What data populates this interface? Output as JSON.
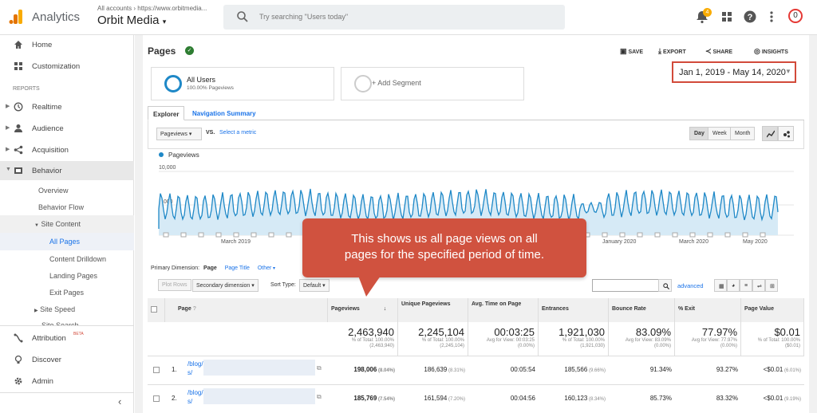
{
  "header": {
    "app": "Analytics",
    "accounts_crumb": "All accounts › https://www.orbitmedia...",
    "property": "Orbit Media",
    "search_placeholder": "Try searching \"Users today\"",
    "notifications": "4",
    "account_initial": "0"
  },
  "sidebar": {
    "home": "Home",
    "customization": "Customization",
    "reports_label": "REPORTS",
    "realtime": "Realtime",
    "audience": "Audience",
    "acquisition": "Acquisition",
    "behavior": "Behavior",
    "overview": "Overview",
    "behavior_flow": "Behavior Flow",
    "site_content": "Site Content",
    "all_pages": "All Pages",
    "content_drilldown": "Content Drilldown",
    "landing_pages": "Landing Pages",
    "exit_pages": "Exit Pages",
    "site_speed": "Site Speed",
    "site_search": "Site Search",
    "attribution": "Attribution",
    "beta": "BETA",
    "discover": "Discover",
    "admin": "Admin"
  },
  "report": {
    "title": "Pages",
    "save": "SAVE",
    "export": "EXPORT",
    "share": "SHARE",
    "insights": "INSIGHTS",
    "segment_name": "All Users",
    "segment_sub": "100.00% Pageviews",
    "add_segment": "+ Add Segment",
    "date_range": "Jan 1, 2019 - May 14, 2020",
    "tab_explorer": "Explorer",
    "tab_nav": "Navigation Summary",
    "metric": "Pageviews",
    "vs": "VS.",
    "select_metric": "Select a metric",
    "day": "Day",
    "week": "Week",
    "month": "Month",
    "legend": "Pageviews",
    "ymax": "10,000",
    "ymid": "5,000",
    "xlabels": [
      "March 2019",
      "January 2020",
      "March 2020",
      "May 2020"
    ],
    "primary_dimension": "Primary Dimension:",
    "dim_page": "Page",
    "dim_page_title": "Page Title",
    "dim_other": "Other",
    "plot_rows": "Plot Rows",
    "secondary_dimension": "Secondary dimension",
    "sort_type": "Sort Type:",
    "sort_default": "Default",
    "advanced": "advanced"
  },
  "callout": {
    "line1": "This shows us all page views on all",
    "line2": "pages for the specified period of time."
  },
  "table": {
    "headers": [
      "Page",
      "Pageviews",
      "Unique Pageviews",
      "Avg. Time on Page",
      "Entrances",
      "Bounce Rate",
      "% Exit",
      "Page Value"
    ],
    "totals": [
      {
        "big": "2,463,940",
        "s1": "% of Total: 100.00%",
        "s2": "(2,463,940)"
      },
      {
        "big": "2,245,104",
        "s1": "% of Total: 100.00%",
        "s2": "(2,245,104)"
      },
      {
        "big": "00:03:25",
        "s1": "Avg for View: 00:03:25",
        "s2": "(0.00%)"
      },
      {
        "big": "1,921,030",
        "s1": "% of Total: 100.00%",
        "s2": "(1,921,030)"
      },
      {
        "big": "83.09%",
        "s1": "Avg for View: 83.09%",
        "s2": "(0.00%)"
      },
      {
        "big": "77.97%",
        "s1": "Avg for View: 77.97%",
        "s2": "(0.00%)"
      },
      {
        "big": "$0.01",
        "s1": "% of Total: 100.00%",
        "s2": "($0.01)"
      }
    ],
    "rows": [
      {
        "n": "1.",
        "page": "/blog/",
        "page2": "s/",
        "pv": "198,006",
        "pvp": "(8.04%)",
        "upv": "186,639",
        "upvp": "(8.31%)",
        "avg": "00:05:54",
        "ent": "185,566",
        "entp": "(9.66%)",
        "br": "91.34%",
        "exit": "93.27%",
        "val": "<$0.01",
        "valp": "(6.01%)"
      },
      {
        "n": "2.",
        "page": "/blog/",
        "page2": "s/",
        "pv": "185,769",
        "pvp": "(7.54%)",
        "upv": "161,594",
        "upvp": "(7.20%)",
        "avg": "00:04:56",
        "ent": "160,123",
        "entp": "(8.34%)",
        "br": "85.73%",
        "exit": "83.32%",
        "val": "<$0.01",
        "valp": "(9.19%)"
      }
    ]
  },
  "colors": {
    "accent": "#1a73e8",
    "line": "#1e88c7",
    "callout": "#d0523f",
    "date_border": "#d24a3a"
  }
}
